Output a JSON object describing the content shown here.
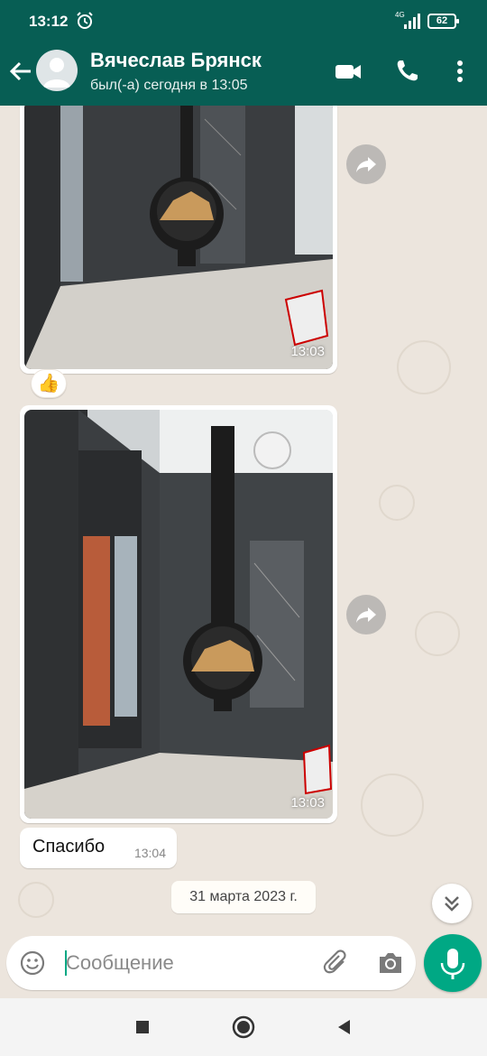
{
  "status_bar": {
    "time": "13:12",
    "network": "4G",
    "battery": "62",
    "icons": [
      "alarm-icon",
      "signal-icon",
      "battery-icon"
    ]
  },
  "header": {
    "contact_name": "Вячеслав Брянск",
    "contact_status": "был(-а) сегодня в 13:05",
    "icons": [
      "back-arrow-icon",
      "avatar-placeholder-icon",
      "video-call-icon",
      "phone-call-icon",
      "more-vert-icon"
    ]
  },
  "messages": [
    {
      "type": "image",
      "time": "13:03",
      "reaction": "👍"
    },
    {
      "type": "image",
      "time": "13:03"
    },
    {
      "type": "text",
      "text": "Спасибо",
      "time": "13:04"
    }
  ],
  "date_separator": "31 марта 2023 г.",
  "composer": {
    "placeholder": "Сообщение",
    "icons": [
      "emoji-icon",
      "attach-icon",
      "camera-icon",
      "mic-icon"
    ]
  },
  "navbar": {
    "icons": [
      "recents-square-icon",
      "home-circle-icon",
      "back-triangle-icon"
    ]
  },
  "colors": {
    "header": "#075e54",
    "accent": "#00a884",
    "chat_bg": "#ece5dd"
  }
}
